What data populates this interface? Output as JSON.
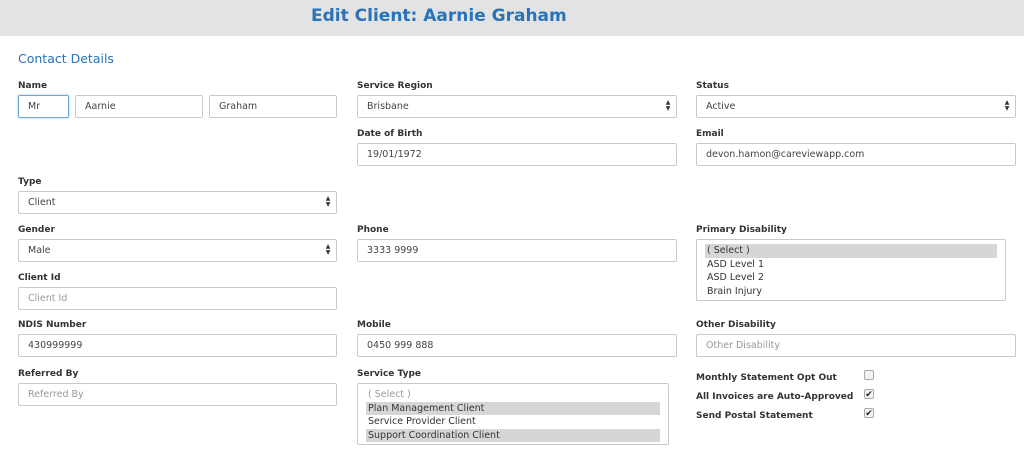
{
  "header": {
    "title": "Edit Client: Aarnie Graham"
  },
  "section": {
    "title": "Contact Details"
  },
  "name": {
    "label": "Name",
    "title": "Mr",
    "first": "Aarnie",
    "last": "Graham"
  },
  "service_region": {
    "label": "Service Region",
    "value": "Brisbane"
  },
  "status": {
    "label": "Status",
    "value": "Active"
  },
  "dob": {
    "label": "Date of Birth",
    "value": "19/01/1972"
  },
  "email": {
    "label": "Email",
    "value": "devon.hamon@careviewapp.com"
  },
  "type": {
    "label": "Type",
    "value": "Client"
  },
  "gender": {
    "label": "Gender",
    "value": "Male"
  },
  "phone": {
    "label": "Phone",
    "value": "3333 9999"
  },
  "primary_disability": {
    "label": "Primary Disability",
    "options": [
      "( Select )",
      "ASD Level 1",
      "ASD Level 2",
      "Brain Injury"
    ]
  },
  "client_id": {
    "label": "Client Id",
    "placeholder": "Client Id"
  },
  "ndis": {
    "label": "NDIS Number",
    "value": "430999999"
  },
  "mobile": {
    "label": "Mobile",
    "value": "0450 999 888"
  },
  "other_disability": {
    "label": "Other Disability",
    "placeholder": "Other Disability"
  },
  "referred_by": {
    "label": "Referred By",
    "placeholder": "Referred By"
  },
  "service_type": {
    "label": "Service Type",
    "options": [
      "( Select )",
      "Plan Management Client",
      "Service Provider Client",
      "Support Coordination Client"
    ]
  },
  "checkboxes": {
    "monthly": {
      "label": "Monthly Statement Opt Out",
      "checked": false
    },
    "auto_approved": {
      "label": "All Invoices are Auto-Approved",
      "checked": true
    },
    "postal": {
      "label": "Send Postal Statement",
      "checked": true
    }
  }
}
